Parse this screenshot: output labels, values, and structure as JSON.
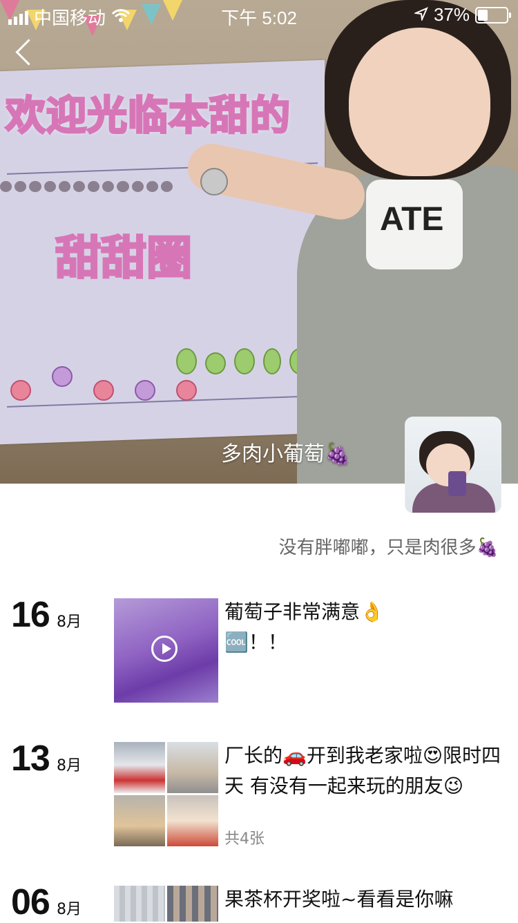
{
  "status_bar": {
    "carrier": "中国移动",
    "time": "下午 5:02",
    "battery": "37%"
  },
  "cover": {
    "title_line1": "欢迎光临本甜的",
    "title_line2": "甜甜圈",
    "shirt_text": "ATE"
  },
  "profile": {
    "username": "多肉小葡萄🍇",
    "signature": "没有胖嘟嘟，只是肉很多🍇"
  },
  "posts": [
    {
      "day": "16",
      "month": "8月",
      "text_line1": "葡萄子非常满意👌",
      "text_line2": "🆒！！",
      "type": "video"
    },
    {
      "day": "13",
      "month": "8月",
      "text": "厂长的🚗开到我老家啦😍限时四天 有没有一起来玩的朋友😉",
      "count": "共4张",
      "type": "grid"
    },
    {
      "day": "06",
      "month": "8月",
      "text": "果茶杯开奖啦~看看是你嘛",
      "type": "grid"
    }
  ],
  "colors": {
    "accent_pink": "#d776b7",
    "video_purple": "#8f63c3"
  }
}
